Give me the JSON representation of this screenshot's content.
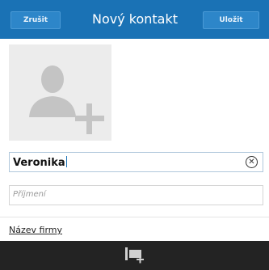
{
  "header": {
    "cancel_label": "Zrušit",
    "title": "Nový kontakt",
    "save_label": "Uložit"
  },
  "form": {
    "first_name_value": "Veronika",
    "last_name_placeholder": "Příjmení",
    "company_label": "Název firmy"
  },
  "icons": {
    "photo": "add-contact-photo-icon",
    "clear": "clear-field-icon",
    "action": "add-field-icon"
  },
  "colors": {
    "header_bg": "#1a72b5",
    "bottom_bar_bg": "#232323"
  }
}
